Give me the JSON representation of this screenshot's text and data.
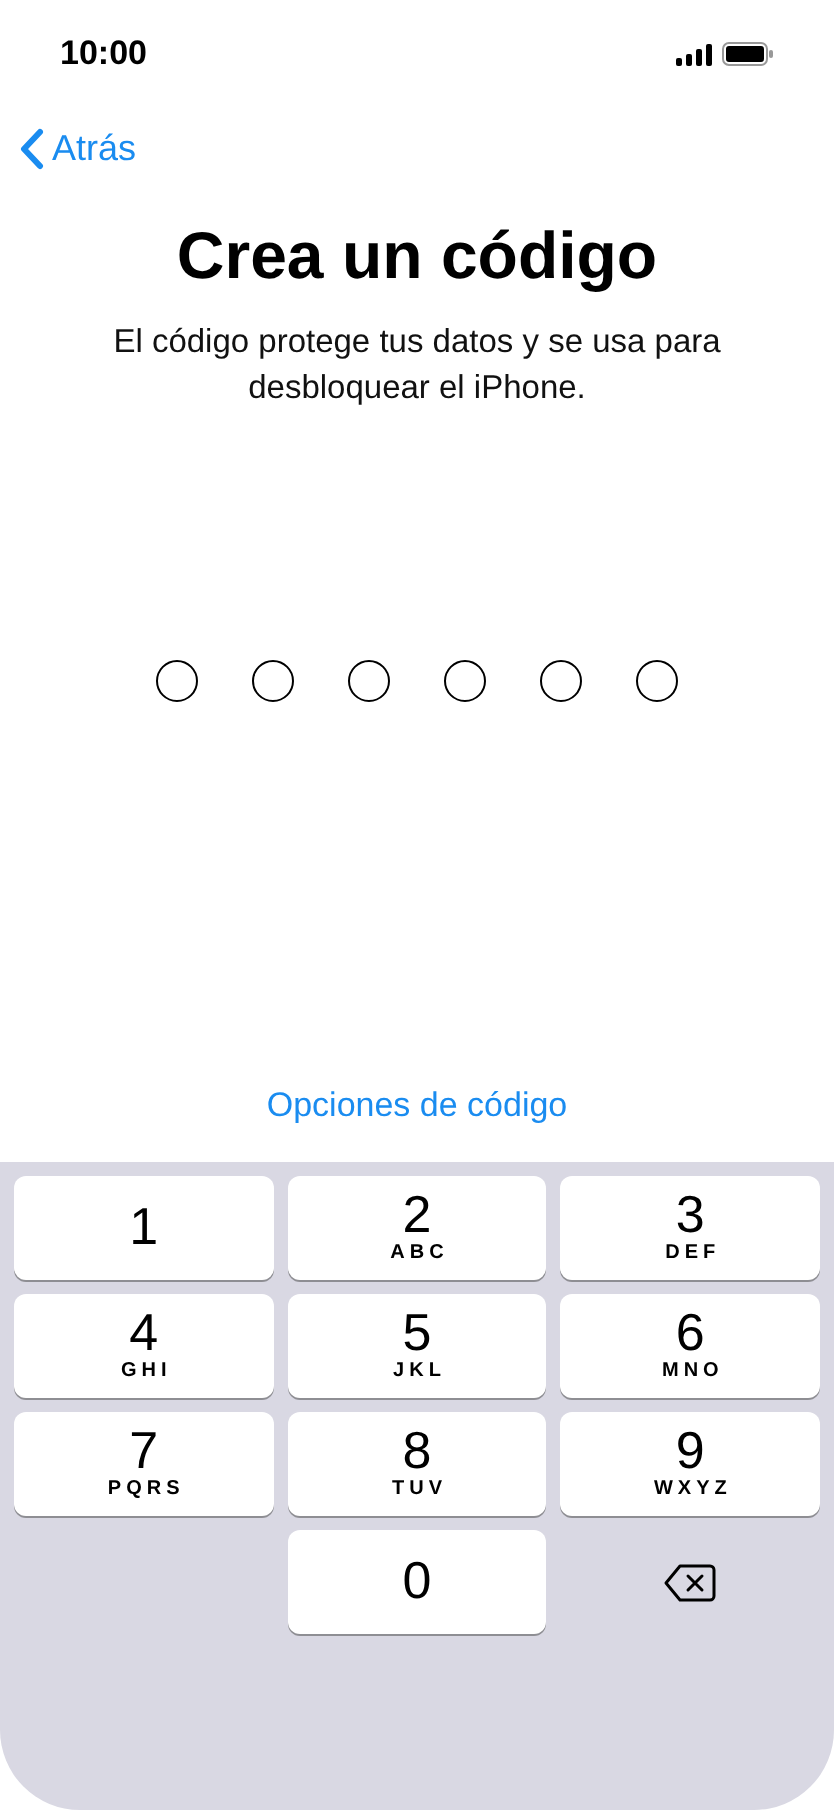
{
  "status_bar": {
    "time": "10:00"
  },
  "nav": {
    "back_label": "Atrás"
  },
  "title": "Crea un código",
  "subtitle": "El código protege tus datos y se usa para desbloquear el iPhone.",
  "passcode_dots": [
    {
      "filled": false
    },
    {
      "filled": false
    },
    {
      "filled": false
    },
    {
      "filled": false
    },
    {
      "filled": false
    },
    {
      "filled": false
    }
  ],
  "options_link": "Opciones de código",
  "keypad": [
    {
      "kind": "digit",
      "digit": "1"
    },
    {
      "kind": "digit",
      "digit": "2",
      "letters": "ABC"
    },
    {
      "kind": "digit",
      "digit": "3",
      "letters": "DEF"
    },
    {
      "kind": "digit",
      "digit": "4",
      "letters": "GHI"
    },
    {
      "kind": "digit",
      "digit": "5",
      "letters": "JKL"
    },
    {
      "kind": "digit",
      "digit": "6",
      "letters": "MNO"
    },
    {
      "kind": "digit",
      "digit": "7",
      "letters": "PQRS"
    },
    {
      "kind": "digit",
      "digit": "8",
      "letters": "TUV"
    },
    {
      "kind": "digit",
      "digit": "9",
      "letters": "WXYZ"
    },
    {
      "kind": "blank"
    },
    {
      "kind": "digit",
      "digit": "0"
    },
    {
      "kind": "delete"
    }
  ]
}
